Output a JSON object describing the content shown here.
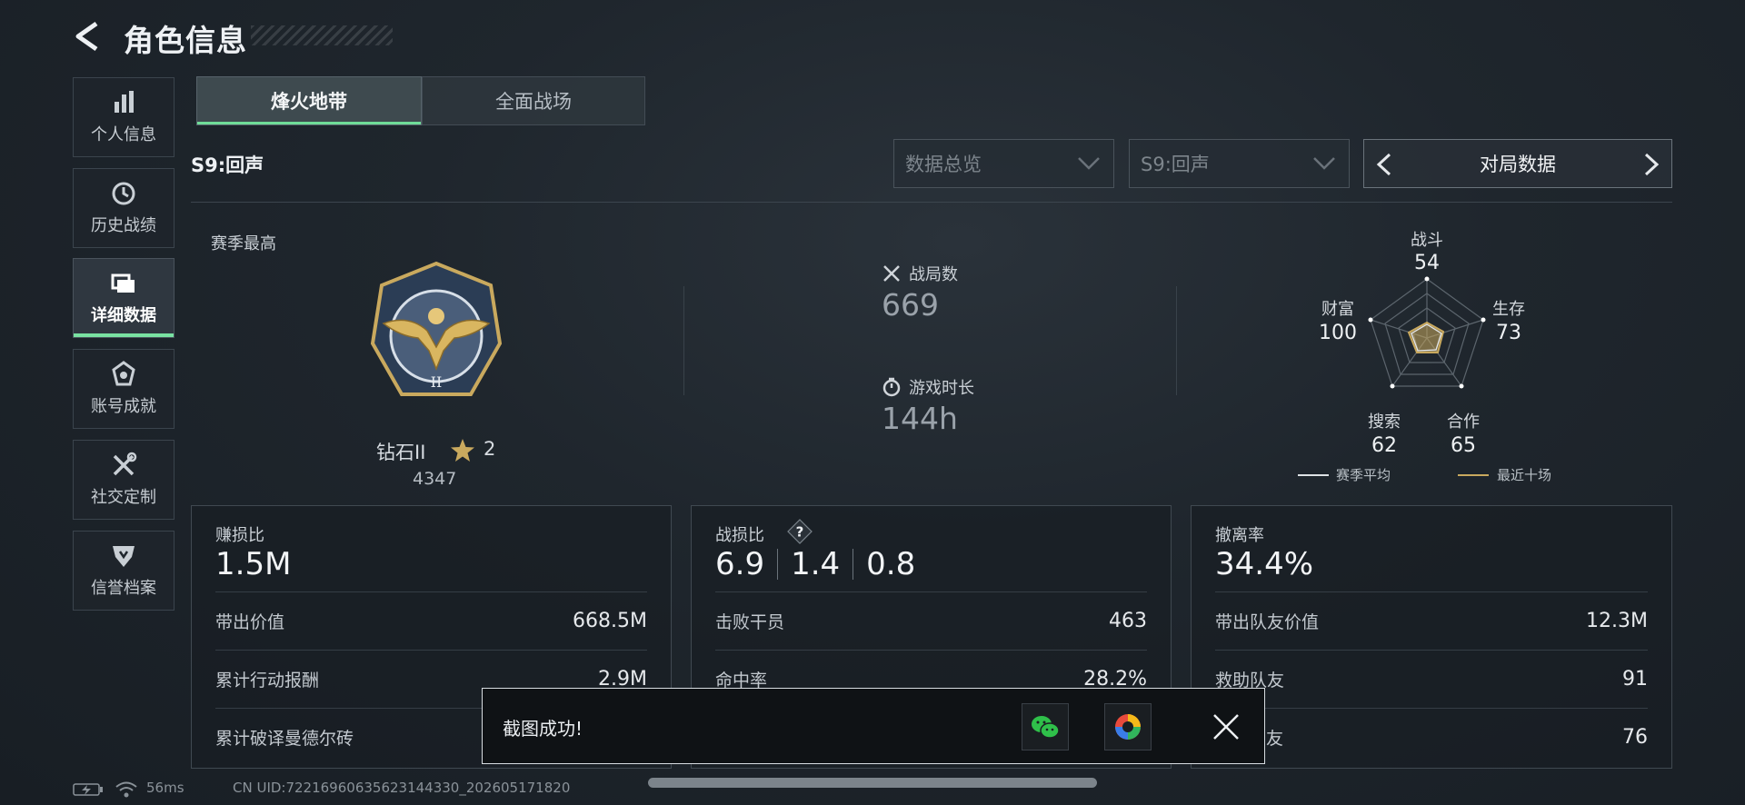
{
  "header": {
    "title": "角色信息"
  },
  "sidebar": {
    "items": [
      {
        "label": "个人信息",
        "icon": "bar-chart-icon"
      },
      {
        "label": "历史战绩",
        "icon": "history-icon"
      },
      {
        "label": "详细数据",
        "icon": "folder-icon",
        "active": true
      },
      {
        "label": "账号成就",
        "icon": "medal-icon"
      },
      {
        "label": "社交定制",
        "icon": "wrench-icon"
      },
      {
        "label": "信誉档案",
        "icon": "shield-icon"
      }
    ]
  },
  "mode_tabs": [
    {
      "label": "烽火地带",
      "active": true
    },
    {
      "label": "全面战场",
      "active": false
    }
  ],
  "season_label": "S9:回声",
  "filters": {
    "data_type": {
      "selected": "数据总览"
    },
    "season": {
      "selected": "S9:回声"
    },
    "stat_view": {
      "label": "对局数据"
    }
  },
  "summary": {
    "season_best_label": "赛季最高",
    "rank_name": "钻石II",
    "rank_stars": "2",
    "rank_points": "4347",
    "matches_label": "战局数",
    "matches_value": "669",
    "playtime_label": "游戏时长",
    "playtime_value": "144h"
  },
  "radar": {
    "axes": [
      {
        "label": "战斗",
        "value": "54"
      },
      {
        "label": "生存",
        "value": "73"
      },
      {
        "label": "合作",
        "value": "65"
      },
      {
        "label": "搜索",
        "value": "62"
      },
      {
        "label": "财富",
        "value": "100"
      }
    ],
    "legend": [
      {
        "label": "赛季平均",
        "color": "#dfe3e6"
      },
      {
        "label": "最近十场",
        "color": "#c9a95e"
      }
    ]
  },
  "cards": [
    {
      "title": "赚损比",
      "value": "1.5M",
      "rows": [
        {
          "label": "带出价值",
          "value": "668.5M"
        },
        {
          "label": "累计行动报酬",
          "value": "2.9M"
        },
        {
          "label": "累计破译曼德尔砖",
          "value": ""
        }
      ]
    },
    {
      "title": "战损比",
      "values": [
        "6.9",
        "1.4",
        "0.8"
      ],
      "rows": [
        {
          "label": "击败干员",
          "value": "463"
        },
        {
          "label": "命中率",
          "value": "28.2%"
        }
      ]
    },
    {
      "title": "撤离率",
      "value": "34.4%",
      "rows": [
        {
          "label": "带出队友价值",
          "value": "12.3M"
        },
        {
          "label": "救助队友",
          "value": "91"
        },
        {
          "label": "友",
          "value": "76"
        }
      ]
    }
  ],
  "toast": {
    "message": "截图成功!"
  },
  "status_bar": {
    "ping": "56ms",
    "uid": "CN UID:72216960635623144330_202605171820"
  }
}
